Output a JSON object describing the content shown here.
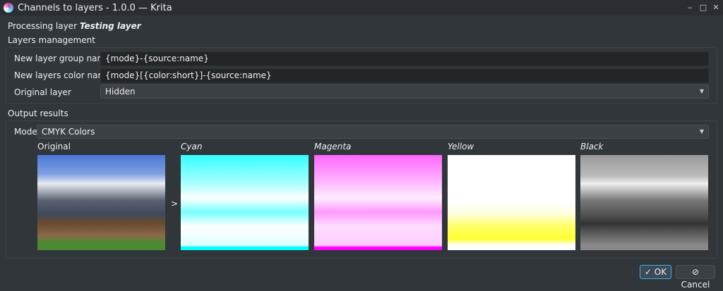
{
  "window": {
    "title": "Channels to layers - 1.0.0 — Krita"
  },
  "processing": {
    "prefix": "Processing layer",
    "layer": "Testing layer"
  },
  "layers_management": {
    "title": "Layers management",
    "group_name_label": "New layer group name",
    "group_name_value": "{mode}-{source:name}",
    "color_name_label": "New layers color name",
    "color_name_value": "{mode}[{color:short}]-{source:name}",
    "original_label": "Original layer",
    "original_value": "Hidden"
  },
  "output": {
    "title": "Output results",
    "mode_label": "Mode",
    "mode_value": "CMYK Colors",
    "original_caption": "Original",
    "arrow": ">",
    "channels": [
      "Cyan",
      "Magenta",
      "Yellow",
      "Black"
    ],
    "channel_colors": [
      "#00ffff",
      "#ff00ff",
      "#ffff00",
      "#000000"
    ]
  },
  "buttons": {
    "ok": "OK",
    "cancel": "Cancel"
  }
}
